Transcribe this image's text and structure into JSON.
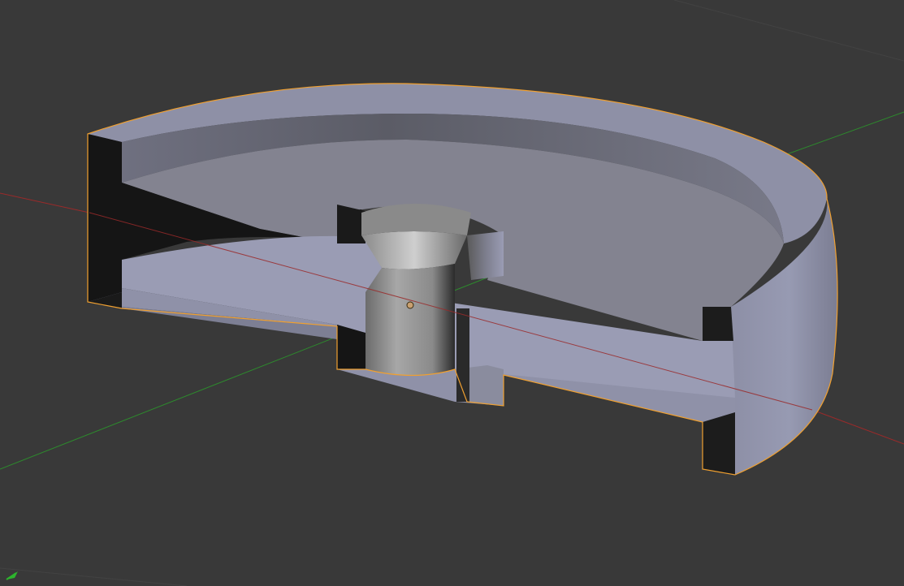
{
  "viewport": {
    "name": "3d-viewport",
    "background": "#393939",
    "grid_color": "#4a4a4a",
    "x_axis_color": "#9a2a2a",
    "y_axis_color": "#2d8a2d",
    "selection_outline_color": "#f0a030",
    "mesh_light_color": "#9a9cb4",
    "mesh_mid_color": "#8c8d9e",
    "mesh_dark_color": "#151515"
  },
  "object": {
    "type": "mesh",
    "selected": true,
    "shape": "cut-away disc with central countersunk hole"
  },
  "icons": {
    "origin": "origin-dot-icon",
    "gizmo": "axis-gizmo-icon"
  }
}
